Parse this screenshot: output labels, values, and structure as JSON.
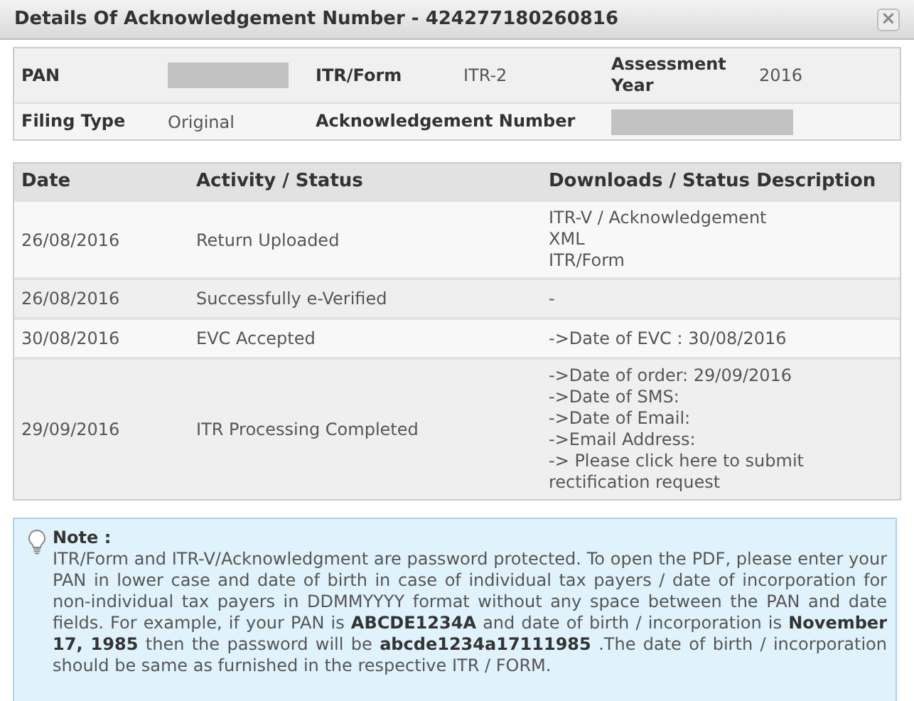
{
  "window": {
    "title": "Details Of Acknowledgement Number - 424277180260816",
    "close": "×"
  },
  "summary": [
    [
      {
        "label": "PAN",
        "redacted": true
      },
      {
        "label": "ITR/Form",
        "value": "ITR-2"
      },
      {
        "label": "Assessment Year",
        "value": "2016"
      }
    ],
    [
      {
        "label": "Filing Type",
        "value": "Original"
      },
      {
        "label": "Acknowledgement Number",
        "redacted": true
      }
    ]
  ],
  "table": {
    "columns": [
      "Date",
      "Activity / Status",
      "Downloads / Status Description"
    ],
    "rows": [
      {
        "date": "26/08/2016",
        "activity": "Return Uploaded",
        "details": [
          "ITR-V / Acknowledgement",
          "XML",
          "ITR/Form"
        ]
      },
      {
        "date": "26/08/2016",
        "activity": "Successfully e-Verified",
        "details": [
          "-"
        ]
      },
      {
        "date": "30/08/2016",
        "activity": "EVC Accepted",
        "details": [
          "->Date of EVC : 30/08/2016"
        ]
      },
      {
        "date": "29/09/2016",
        "activity": "ITR Processing Completed",
        "details": [
          "->Date of order: 29/09/2016",
          "->Date of SMS:",
          "->Date of Email:",
          "->Email Address:",
          "-> Please click here to submit rectification request"
        ]
      }
    ]
  },
  "note": {
    "title": "Note :",
    "text": "ITR/Form and ITR-V/Acknowledgment are password protected. To open the PDF, please enter your PAN in lower case and date of birth in case of individual tax payers / date of incorporation for non-individual tax payers in DDMMYYYY format without any space between the PAN and date fields. For example, if your PAN is **ABCDE1234A** and date of birth / incorporation is **November 17, 1985** then the password will be **abcde1234a17111985** .The date of birth / incorporation should be same as furnished in the respective ITR / FORM."
  }
}
